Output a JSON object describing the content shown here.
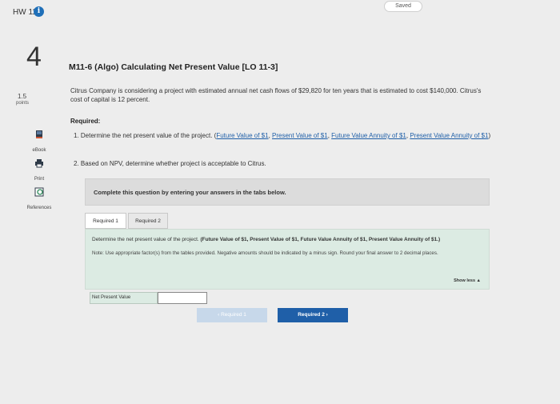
{
  "header": {
    "hw_label": "HW 11",
    "info_glyph": "i",
    "saved_label": "Saved"
  },
  "question": {
    "number": "4",
    "points_value": "1.5",
    "points_label": "points",
    "title": "M11-6 (Algo) Calculating Net Present Value [LO 11-3]",
    "body": "Citrus Company is considering a project with estimated annual net cash flows of $29,820 for ten years that is estimated to cost $140,000. Citrus's cost of capital is 12 percent.",
    "required_heading": "Required:",
    "req1_text": "1. Determine the net present value of the project. (",
    "req1_links": [
      "Future Value of $1",
      "Present Value of $1",
      "Future Value Annuity of $1",
      "Present Value Annuity of $1"
    ],
    "req1_sep": ", ",
    "req1_close": ")",
    "req2_text": "2. Based on NPV, determine whether project is acceptable to Citrus."
  },
  "side_tools": {
    "ebook": "eBook",
    "print": "Print",
    "references": "References"
  },
  "instruction_box": "Complete this question by entering your answers in the tabs below.",
  "tabs": [
    {
      "label": "Required 1",
      "active": true
    },
    {
      "label": "Required 2",
      "active": false
    }
  ],
  "panel": {
    "line1_prefix": "Determine the net present value of the project. ",
    "line1_bold": "(Future Value of $1, Present Value of $1, Future Value Annuity of $1, Present Value Annuity of $1.)",
    "note": "Note: Use appropriate factor(s) from the tables provided. Negative amounts should be indicated by a minus sign. Round your final answer to 2 decimal places.",
    "show_less": "Show less ▲"
  },
  "npv": {
    "label": "Net Present Value",
    "value": ""
  },
  "nav": {
    "prev_label": "‹  Required 1",
    "next_label": "Required 2  ›"
  },
  "colors": {
    "accent": "#1f5fa8",
    "panel_bg": "#dcebe3",
    "page_bg": "#ededed"
  }
}
